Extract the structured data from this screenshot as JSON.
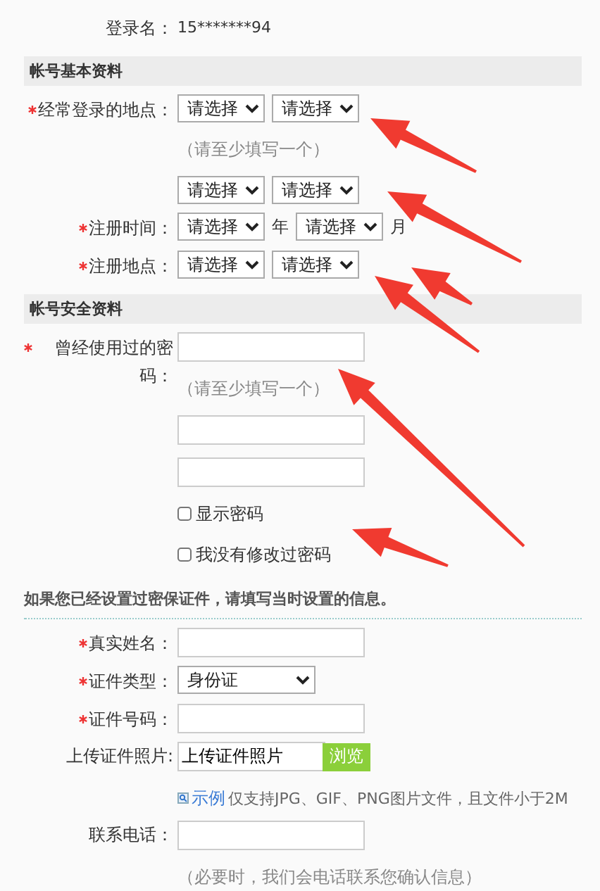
{
  "login": {
    "label": "登录名：",
    "value": "15*******94"
  },
  "sections": [
    {
      "title": "帐号基本资料",
      "rows": [
        {
          "label": "经常登录的地点：",
          "required": true,
          "lines": [
            [
              {
                "kind": "select",
                "value": "请选择"
              },
              {
                "kind": "select",
                "value": "请选择"
              }
            ],
            [
              {
                "kind": "hint",
                "text": "（请至少填写一个）"
              }
            ],
            [
              {
                "kind": "select",
                "value": "请选择"
              },
              {
                "kind": "select",
                "value": "请选择"
              }
            ]
          ]
        },
        {
          "label": "注册时间：",
          "required": true,
          "lines": [
            [
              {
                "kind": "select",
                "value": "请选择"
              },
              {
                "kind": "unit",
                "text": "年"
              },
              {
                "kind": "select",
                "value": "请选择"
              },
              {
                "kind": "unit",
                "text": "月"
              }
            ]
          ]
        },
        {
          "label": "注册地点：",
          "required": true,
          "lines": [
            [
              {
                "kind": "select",
                "value": "请选择"
              },
              {
                "kind": "select",
                "value": "请选择"
              }
            ]
          ]
        }
      ]
    },
    {
      "title": "帐号安全资料",
      "rows": [
        {
          "label": "曾经使用过的密码：",
          "required": true,
          "lines": [
            [
              {
                "kind": "input"
              }
            ],
            [
              {
                "kind": "hint",
                "text": "（请至少填写一个）"
              }
            ],
            [
              {
                "kind": "input"
              }
            ],
            [
              {
                "kind": "input"
              }
            ],
            [
              {
                "kind": "checkbox",
                "label": "显示密码",
                "checked": false
              }
            ],
            [
              {
                "kind": "checkbox",
                "label": "我没有修改过密码",
                "checked": false
              }
            ]
          ]
        }
      ]
    }
  ],
  "notice": "如果您已经设置过密保证件，请填写当时设置的信息。",
  "cert_rows": [
    {
      "label": "真实姓名：",
      "required": true,
      "lines": [
        [
          {
            "kind": "input"
          }
        ]
      ]
    },
    {
      "label": "证件类型：",
      "required": true,
      "lines": [
        [
          {
            "kind": "wideselect",
            "value": "身份证"
          }
        ]
      ]
    },
    {
      "label": "证件号码：",
      "required": true,
      "lines": [
        [
          {
            "kind": "input"
          }
        ]
      ]
    },
    {
      "label": "上传证件照片:",
      "required": false,
      "lines": [
        [
          {
            "kind": "file",
            "value": "上传证件照片"
          },
          {
            "kind": "browse",
            "text": "浏览"
          }
        ],
        [
          {
            "kind": "example",
            "link": "示例",
            "text": "仅支持JPG、GIF、PNG图片文件，且文件小于2M"
          }
        ]
      ]
    },
    {
      "label": "联系电话：",
      "required": false,
      "lines": [
        [
          {
            "kind": "input"
          }
        ],
        [
          {
            "kind": "hint",
            "text": "（必要时，我们会电话联系您确认信息）"
          }
        ]
      ]
    }
  ]
}
